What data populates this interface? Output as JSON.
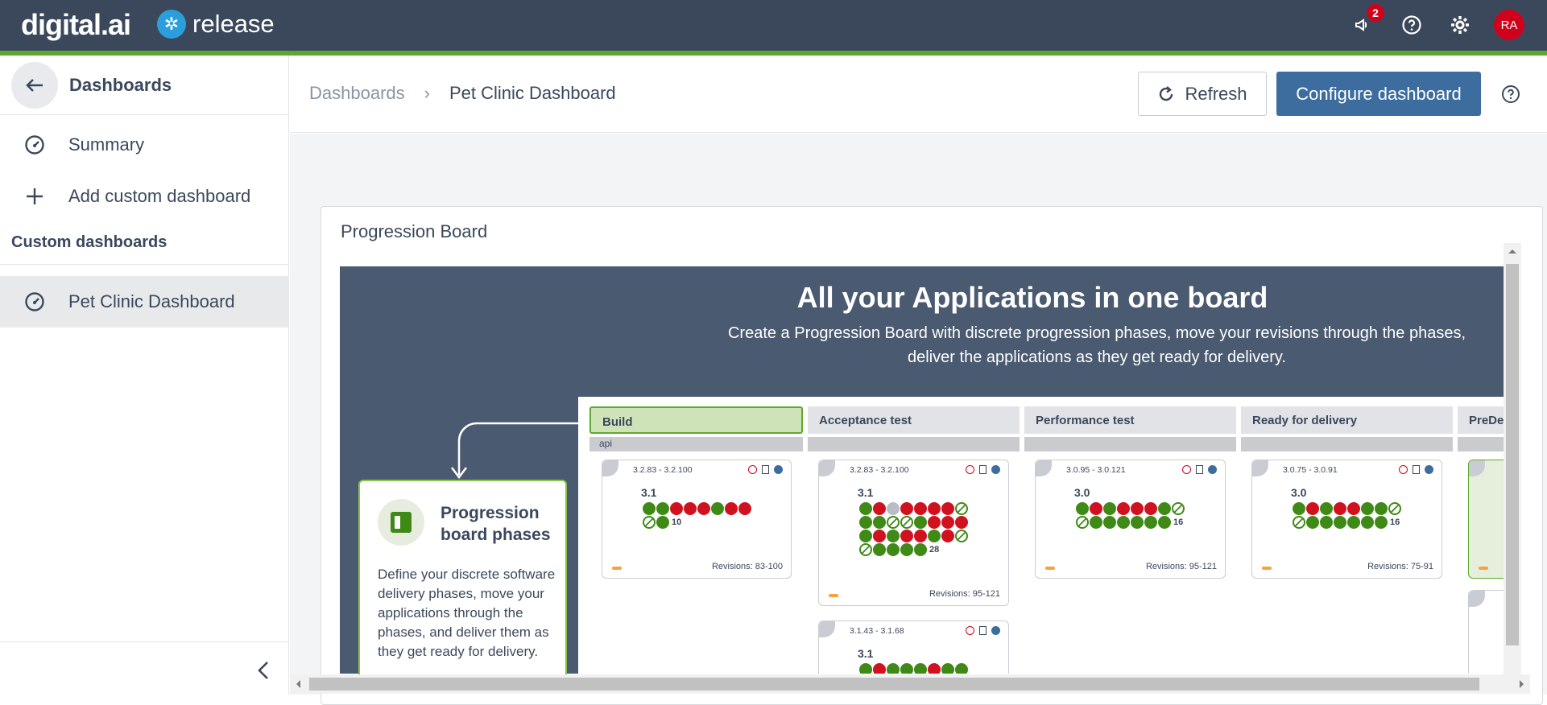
{
  "app": {
    "brand": "digital.ai",
    "product": "release",
    "notification_count": "2",
    "avatar_initials": "RA",
    "colors": {
      "topbar": "#3b485c",
      "accent": "#5fa82e",
      "primary": "#3d6c9e",
      "danger": "#d0021b"
    }
  },
  "icons": {
    "notifications": "megaphone-icon",
    "help": "help-circle-icon",
    "settings": "gear-icon",
    "back": "arrow-left-icon",
    "summary": "dashboard-gauge-icon",
    "add": "plus-icon",
    "refresh": "refresh-icon",
    "collapse": "chevron-left-icon"
  },
  "sidebar": {
    "title": "Dashboards",
    "items": [
      {
        "label": "Summary"
      },
      {
        "label": "Add custom dashboard"
      }
    ],
    "section_title": "Custom dashboards",
    "custom_items": [
      {
        "label": "Pet Clinic Dashboard",
        "active": true
      }
    ]
  },
  "header": {
    "breadcrumb_root": "Dashboards",
    "breadcrumb_current": "Pet Clinic Dashboard",
    "refresh_label": "Refresh",
    "configure_label": "Configure dashboard"
  },
  "tile": {
    "title": "Progression Board",
    "board_title": "All your Applications in one board",
    "board_subtitle_line1": "Create a Progression Board with discrete  progression phases, move your revisions through the phases,",
    "board_subtitle_line2": "deliver the applications as they get ready for delivery.",
    "phases_card": {
      "title": "Progression board phases",
      "description": "Define your discrete software delivery phases, move your applications through the phases, and deliver them as they get ready for delivery."
    },
    "phases": [
      {
        "label": "Build"
      },
      {
        "label": "Acceptance test"
      },
      {
        "label": "Performance test"
      },
      {
        "label": "Ready for delivery"
      },
      {
        "label": "PreDe"
      }
    ],
    "lane_label": "api",
    "cards": [
      {
        "range": "3.2.83 - 3.2.100",
        "version": "3.1",
        "count": "10",
        "revisions": "Revisions: 83-100"
      },
      {
        "range": "3.2.83 - 3.2.100",
        "version": "3.1",
        "count": "28",
        "revisions": "Revisions: 95-121"
      },
      {
        "range": "3.0.95 - 3.0.121",
        "version": "3.0",
        "count": "16",
        "revisions": "Revisions: 95-121"
      },
      {
        "range": "3.0.75 - 3.0.91",
        "version": "3.0",
        "count": "16",
        "revisions": "Revisions: 75-91"
      },
      {
        "range": "3.1.43 - 3.1.68",
        "version": "3.1"
      }
    ]
  }
}
